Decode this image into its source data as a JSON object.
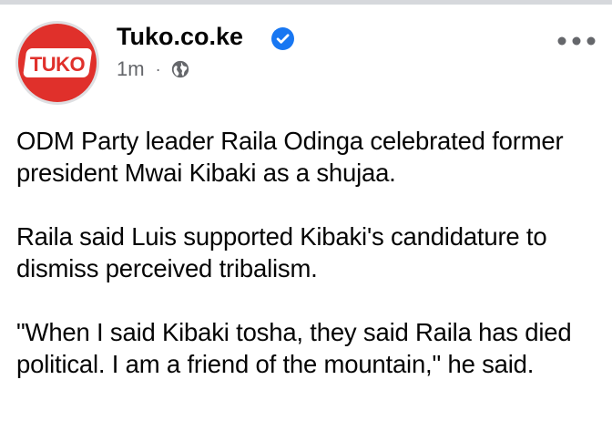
{
  "header": {
    "page_name": "Tuko.co.ke",
    "logo_text": "TUKO",
    "timestamp": "1m",
    "separator": "·",
    "audience_icon": "globe-icon",
    "verified_icon": "verified-badge-icon",
    "more_icon": "more-options-icon"
  },
  "colors": {
    "brand_red": "#e0302b",
    "verified_blue": "#1877f2",
    "text": "#050505",
    "secondary_text": "#65676b"
  },
  "post": {
    "paragraphs": [
      "ODM Party leader Raila Odinga celebrated former president Mwai Kibaki as a shujaa.",
      "Raila said Luis supported Kibaki's candidature to dismiss perceived tribalism.",
      "\"When I said Kibaki tosha, they said Raila has died political. I am a friend of the mountain,\" he said."
    ]
  }
}
